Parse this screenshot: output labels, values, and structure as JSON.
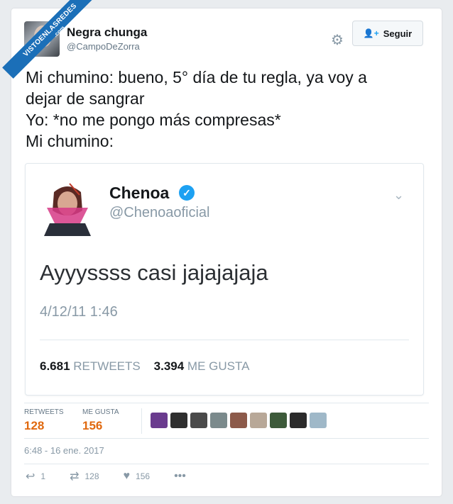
{
  "watermark": {
    "text": "VISTOENLASREDES",
    "sub": ".com"
  },
  "tweet": {
    "name": "Negra chunga",
    "handle": "@CampoDeZorra",
    "follow_label": "Seguir",
    "text_lines": [
      "Mi chumino: bueno, 5° día de tu regla, ya voy a",
      "dejar de sangrar",
      "Yo: *no me pongo más compresas*",
      "Mi chumino:"
    ],
    "timestamp": "6:48 - 16 ene. 2017"
  },
  "quoted": {
    "name": "Chenoa",
    "handle": "@Chenoaoficial",
    "text": "Ayyyssss casi jajajajaja",
    "date": "4/12/11 1:46",
    "retweets_count": "6.681",
    "retweets_label": "RETWEETS",
    "likes_count": "3.394",
    "likes_label": "ME GUSTA"
  },
  "stats": {
    "retweets_label": "RETWEETS",
    "retweets": "128",
    "likes_label": "ME GUSTA",
    "likes": "156"
  },
  "actions": {
    "reply_count": "1",
    "retweet_count": "128",
    "like_count": "156"
  },
  "likers": [
    "#6a3b8e",
    "#2f2f2f",
    "#4a4a4a",
    "#7b8a8c",
    "#8c5a4a",
    "#b8a898",
    "#3d5a3a",
    "#2b2b2b",
    "#9fb8c8"
  ],
  "colors": {
    "accent": "#1da1f2",
    "stat_value": "#e0690f",
    "banner": "#1b6fb8"
  }
}
